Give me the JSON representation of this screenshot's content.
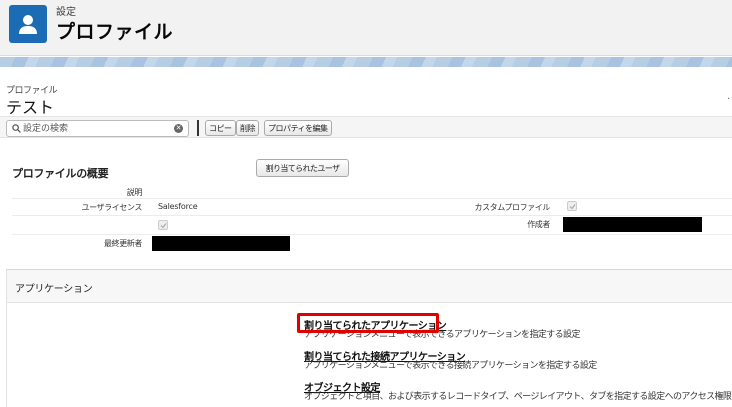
{
  "header": {
    "eyebrow": "設定",
    "title": "プロファイル"
  },
  "record": {
    "type_label": "プロファイル",
    "name": "テスト"
  },
  "toolbar": {
    "search_placeholder": "設定の検索",
    "clear_symbol": "✕",
    "copy_label": "コピー",
    "delete_label": "削除",
    "edit_props_label": "プロパティを編集"
  },
  "overview": {
    "heading": "プロファイルの概要",
    "assigned_users_label": "割り当てられたユーザ",
    "description_label": "説明",
    "user_license_label": "ユーザライセンス",
    "user_license_value": "Salesforce",
    "custom_profile_label": "カスタムプロファイル",
    "custom_profile_checked": true,
    "second_checkbox_checked": true,
    "created_by_label": "作成者",
    "modified_by_label": "最終更新者"
  },
  "applications": {
    "title": "アプリケーション",
    "items": [
      {
        "link": "割り当てられたアプリケーション",
        "desc": "アプリケーションメニューで表示できるアプリケーションを指定する設定"
      },
      {
        "link": "割り当てられた接続アプリケーション",
        "desc": "アプリケーションメニューで表示できる接続アプリケーションを指定する設定"
      },
      {
        "link": "オブジェクト設定",
        "desc": "オブジェクトと項目、および表示するレコードタイプ、ページレイアウト、タブを指定する設定へのアクセス権限"
      }
    ]
  },
  "colors": {
    "header_icon_bg": "#1b6cb5",
    "highlight_border": "#e00000"
  }
}
